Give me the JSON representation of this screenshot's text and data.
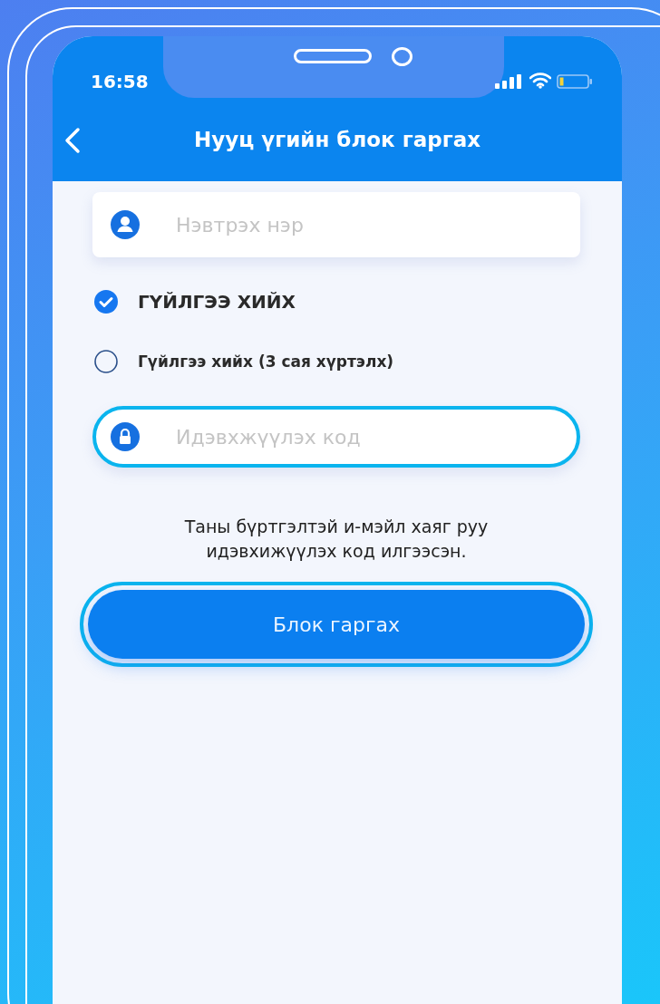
{
  "status_bar": {
    "time": "16:58"
  },
  "header": {
    "title": "Нууц үгийн блок гаргах"
  },
  "username_field": {
    "placeholder": "Нэвтрэх нэр",
    "highlighted": false
  },
  "options": [
    {
      "kind": "radio",
      "label": "ГҮЙЛГЭЭ ХИЙХ",
      "selected": true
    },
    {
      "kind": "radio",
      "label": "Гүйлгээ хийх (3 сая хүртэлх)",
      "selected": false
    }
  ],
  "code_field": {
    "placeholder": "Идэвхжүүлэх код",
    "highlighted": true
  },
  "info_text": "Таны бүртгэлтэй и-мэйл хаяг руу идэвхижүүлэх код илгээсэн.",
  "submit_button": {
    "label": "Блок гаргах",
    "highlighted": true
  }
}
